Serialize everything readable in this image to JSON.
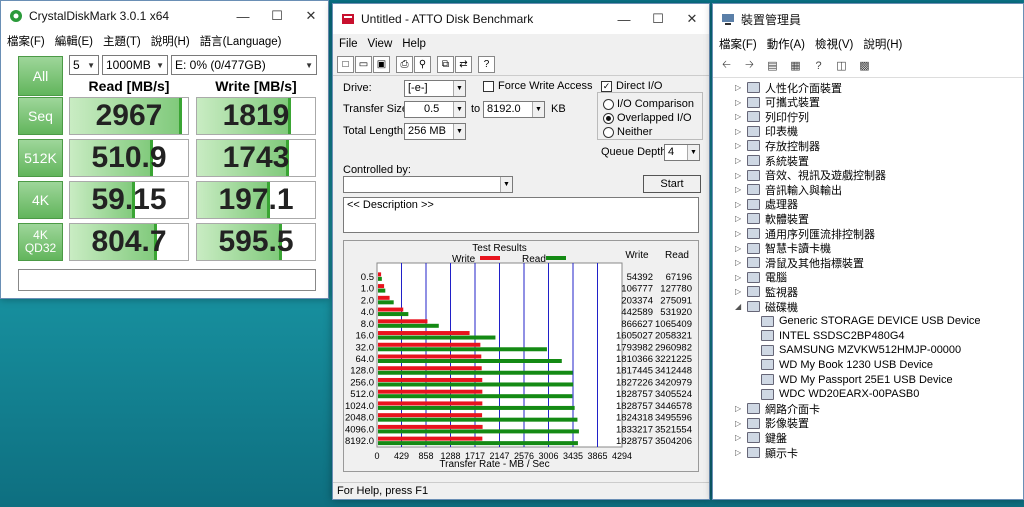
{
  "cdm": {
    "title": "CrystalDiskMark 3.0.1 x64",
    "menu": [
      "檔案(F)",
      "編輯(E)",
      "主題(T)",
      "說明(H)",
      "語言(Language)"
    ],
    "all_label": "All",
    "count": "5",
    "size": "1000MB",
    "drive": "E: 0% (0/477GB)",
    "read_header": "Read [MB/s]",
    "write_header": "Write [MB/s]",
    "rows": [
      {
        "label": "Seq",
        "read": "2967",
        "write": "1819",
        "read_fill": 0.95,
        "write_fill": 0.8
      },
      {
        "label": "512K",
        "read": "510.9",
        "write": "1743",
        "read_fill": 0.7,
        "write_fill": 0.78
      },
      {
        "label": "4K",
        "read": "59.15",
        "write": "197.1",
        "read_fill": 0.55,
        "write_fill": 0.62
      },
      {
        "label": "4K\nQD32",
        "read": "804.7",
        "write": "595.5",
        "read_fill": 0.74,
        "write_fill": 0.72
      }
    ],
    "colors": {
      "accent": "#62b55c",
      "bar": "#3aa534"
    }
  },
  "atto": {
    "title": "Untitled - ATTO Disk Benchmark",
    "menu": [
      "File",
      "View",
      "Help"
    ],
    "drive_label": "Drive:",
    "drive_value": "[-e-]",
    "force_write_label": "Force Write Access",
    "direct_io_label": "Direct I/O",
    "transfer_label": "Transfer Size:",
    "transfer_from": "0.5",
    "to_label": "to",
    "transfer_to": "8192.0",
    "kb_label": "KB",
    "total_label": "Total Length:",
    "total_value": "256 MB",
    "io_comparison": "I/O Comparison",
    "overlapped_io": "Overlapped I/O",
    "neither": "Neither",
    "queue_label": "Queue Depth:",
    "queue_value": "4",
    "controlled_label": "Controlled by:",
    "start_label": "Start",
    "description": "<< Description >>",
    "status": "For Help, press F1"
  },
  "chart_data": {
    "type": "bar",
    "title": "Test Results",
    "xlabel": "Transfer Rate - MB / Sec",
    "legend": [
      "Write",
      "Read"
    ],
    "colors": {
      "write": "#e8141e",
      "read": "#148a14"
    },
    "col_write": "Write",
    "col_read": "Read",
    "categories": [
      "0.5",
      "1.0",
      "2.0",
      "4.0",
      "8.0",
      "16.0",
      "32.0",
      "64.0",
      "128.0",
      "256.0",
      "512.0",
      "1024.0",
      "2048.0",
      "4096.0",
      "8192.0"
    ],
    "x_ticks": [
      "0",
      "429",
      "858",
      "1288",
      "1717",
      "2147",
      "2576",
      "3006",
      "3435",
      "3865",
      "4294"
    ],
    "xlim": [
      0,
      4294
    ],
    "series": [
      {
        "name": "Write",
        "values": [
          54392,
          106777,
          203374,
          442589,
          866627,
          1605027,
          1793982,
          1810366,
          1817445,
          1827226,
          1828757,
          1828757,
          1824318,
          1833217,
          1828757
        ]
      },
      {
        "name": "Read",
        "values": [
          67196,
          127780,
          275091,
          531920,
          1065409,
          2058321,
          2960982,
          3221225,
          3412448,
          3420979,
          3405524,
          3446578,
          3495596,
          3521554,
          3504206
        ]
      }
    ]
  },
  "dm": {
    "title": "裝置管理員",
    "menu": [
      "檔案(F)",
      "動作(A)",
      "檢視(V)",
      "說明(H)"
    ],
    "items": [
      {
        "label": "人性化介面裝置",
        "level": 0
      },
      {
        "label": "可攜式裝置",
        "level": 0
      },
      {
        "label": "列印佇列",
        "level": 0
      },
      {
        "label": "印表機",
        "level": 0
      },
      {
        "label": "存放控制器",
        "level": 0
      },
      {
        "label": "系統裝置",
        "level": 0
      },
      {
        "label": "音效、視訊及遊戲控制器",
        "level": 0
      },
      {
        "label": "音訊輸入與輸出",
        "level": 0
      },
      {
        "label": "處理器",
        "level": 0
      },
      {
        "label": "軟體裝置",
        "level": 0
      },
      {
        "label": "通用序列匯流排控制器",
        "level": 0
      },
      {
        "label": "智慧卡讀卡機",
        "level": 0
      },
      {
        "label": "滑鼠及其他指標裝置",
        "level": 0
      },
      {
        "label": "電腦",
        "level": 0
      },
      {
        "label": "監視器",
        "level": 0
      },
      {
        "label": "磁碟機",
        "level": 0,
        "expanded": true
      },
      {
        "label": "Generic STORAGE DEVICE USB Device",
        "level": 1
      },
      {
        "label": "INTEL SSDSC2BP480G4",
        "level": 1
      },
      {
        "label": "SAMSUNG MZVKW512HMJP-00000",
        "level": 1
      },
      {
        "label": "WD My Book 1230 USB Device",
        "level": 1
      },
      {
        "label": "WD My Passport 25E1 USB Device",
        "level": 1
      },
      {
        "label": "WDC WD20EARX-00PASB0",
        "level": 1
      },
      {
        "label": "網路介面卡",
        "level": 0
      },
      {
        "label": "影像裝置",
        "level": 0
      },
      {
        "label": "鍵盤",
        "level": 0
      },
      {
        "label": "顯示卡",
        "level": 0
      }
    ]
  }
}
